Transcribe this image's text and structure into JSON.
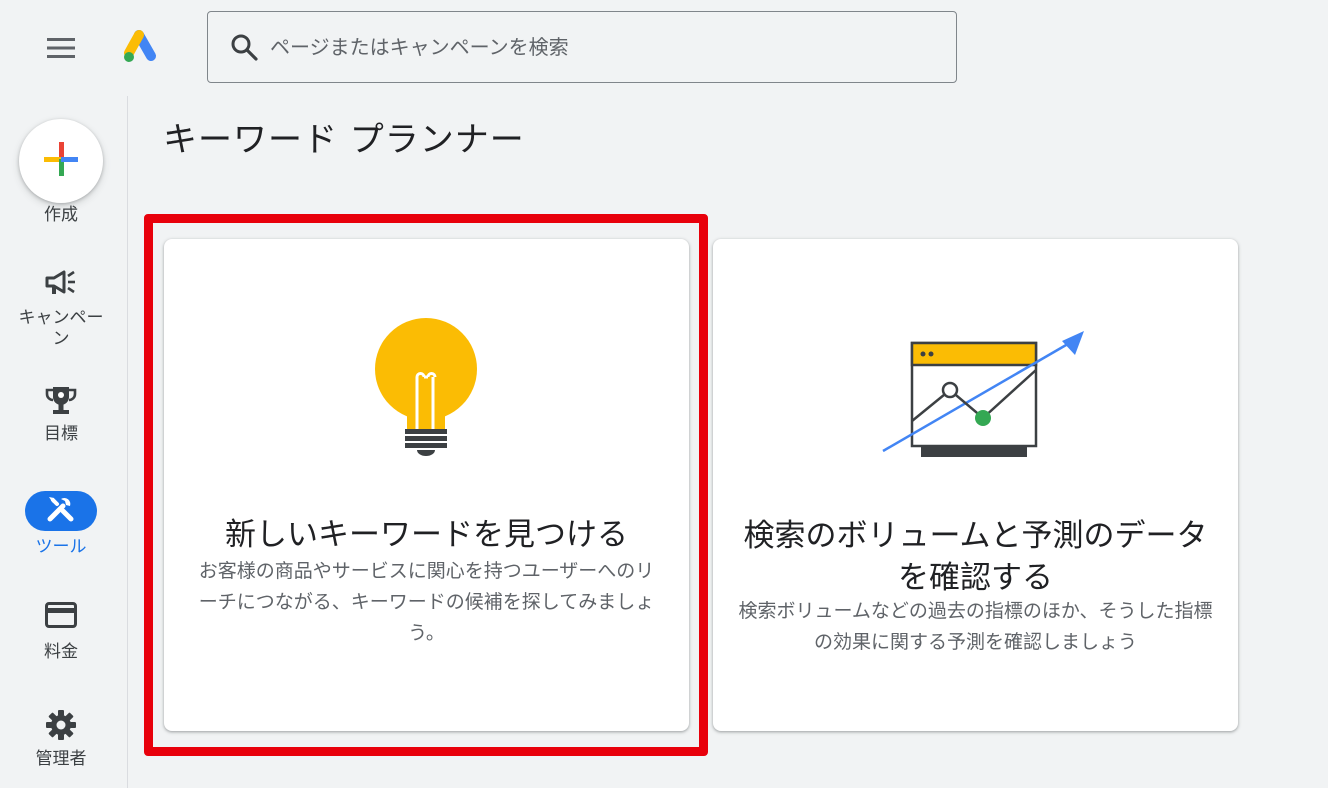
{
  "search": {
    "placeholder": "ページまたはキャンペーンを検索"
  },
  "sidebar": {
    "items": [
      {
        "label": "作成"
      },
      {
        "label": "キャンペーン"
      },
      {
        "label": "目標"
      },
      {
        "label": "ツール",
        "active": true
      },
      {
        "label": "料金"
      },
      {
        "label": "管理者"
      }
    ]
  },
  "page": {
    "title": "キーワード プランナー"
  },
  "cards": [
    {
      "title": "新しいキーワードを見つける",
      "description": "お客様の商品やサービスに関心を持つユーザーへのリーチにつながる、キーワードの候補を探してみましょう。",
      "icon": "lightbulb-icon"
    },
    {
      "title": "検索のボリュームと予測のデータを確認する",
      "description": "検索ボリュームなどの過去の指標のほか、そうした指標の効果に関する予測を確認しましょう",
      "icon": "chart-forecast-icon"
    }
  ],
  "colors": {
    "accent": "#1a73e8",
    "highlight": "#e8000b",
    "yellow": "#fbbc04",
    "green": "#34a853",
    "red": "#ea4335"
  }
}
